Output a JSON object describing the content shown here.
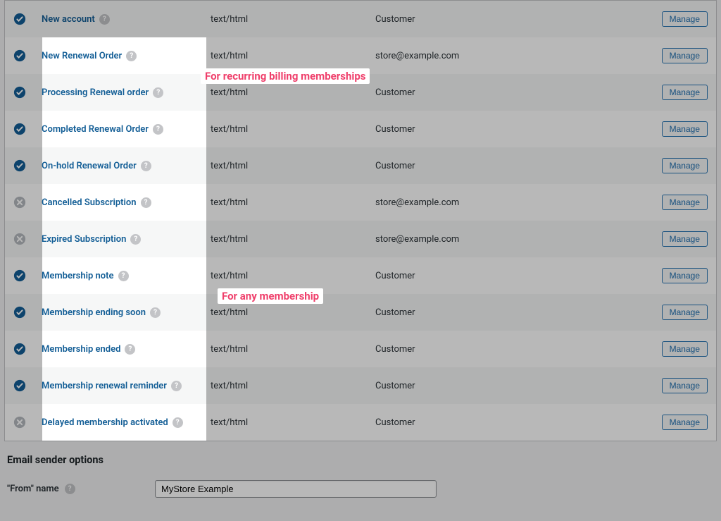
{
  "emails": [
    {
      "status": "on",
      "name": "New account",
      "content_type": "text/html",
      "recipient": "Customer",
      "action": "Manage"
    },
    {
      "status": "on",
      "name": "New Renewal Order",
      "content_type": "text/html",
      "recipient": "store@example.com",
      "action": "Manage"
    },
    {
      "status": "on",
      "name": "Processing Renewal order",
      "content_type": "text/html",
      "recipient": "Customer",
      "action": "Manage"
    },
    {
      "status": "on",
      "name": "Completed Renewal Order",
      "content_type": "text/html",
      "recipient": "Customer",
      "action": "Manage"
    },
    {
      "status": "on",
      "name": "On-hold Renewal Order",
      "content_type": "text/html",
      "recipient": "Customer",
      "action": "Manage"
    },
    {
      "status": "off",
      "name": "Cancelled Subscription",
      "content_type": "text/html",
      "recipient": "store@example.com",
      "action": "Manage"
    },
    {
      "status": "off",
      "name": "Expired Subscription",
      "content_type": "text/html",
      "recipient": "store@example.com",
      "action": "Manage"
    },
    {
      "status": "on",
      "name": "Membership note",
      "content_type": "text/html",
      "recipient": "Customer",
      "action": "Manage"
    },
    {
      "status": "on",
      "name": "Membership ending soon",
      "content_type": "text/html",
      "recipient": "Customer",
      "action": "Manage"
    },
    {
      "status": "on",
      "name": "Membership ended",
      "content_type": "text/html",
      "recipient": "Customer",
      "action": "Manage"
    },
    {
      "status": "on",
      "name": "Membership renewal reminder",
      "content_type": "text/html",
      "recipient": "Customer",
      "action": "Manage"
    },
    {
      "status": "off",
      "name": "Delayed membership activated",
      "content_type": "text/html",
      "recipient": "Customer",
      "action": "Manage"
    }
  ],
  "sender_options": {
    "heading": "Email sender options",
    "from_name_label": "\"From\" name",
    "from_name_value": "MyStore Example"
  },
  "annotations": {
    "group1": "For recurring billing memberships",
    "group2": "For any membership"
  },
  "highlight": {
    "window1_rows": {
      "start_index": 1,
      "end_index": 6
    },
    "window2_rows": {
      "start_index": 7,
      "end_index": 11
    }
  }
}
